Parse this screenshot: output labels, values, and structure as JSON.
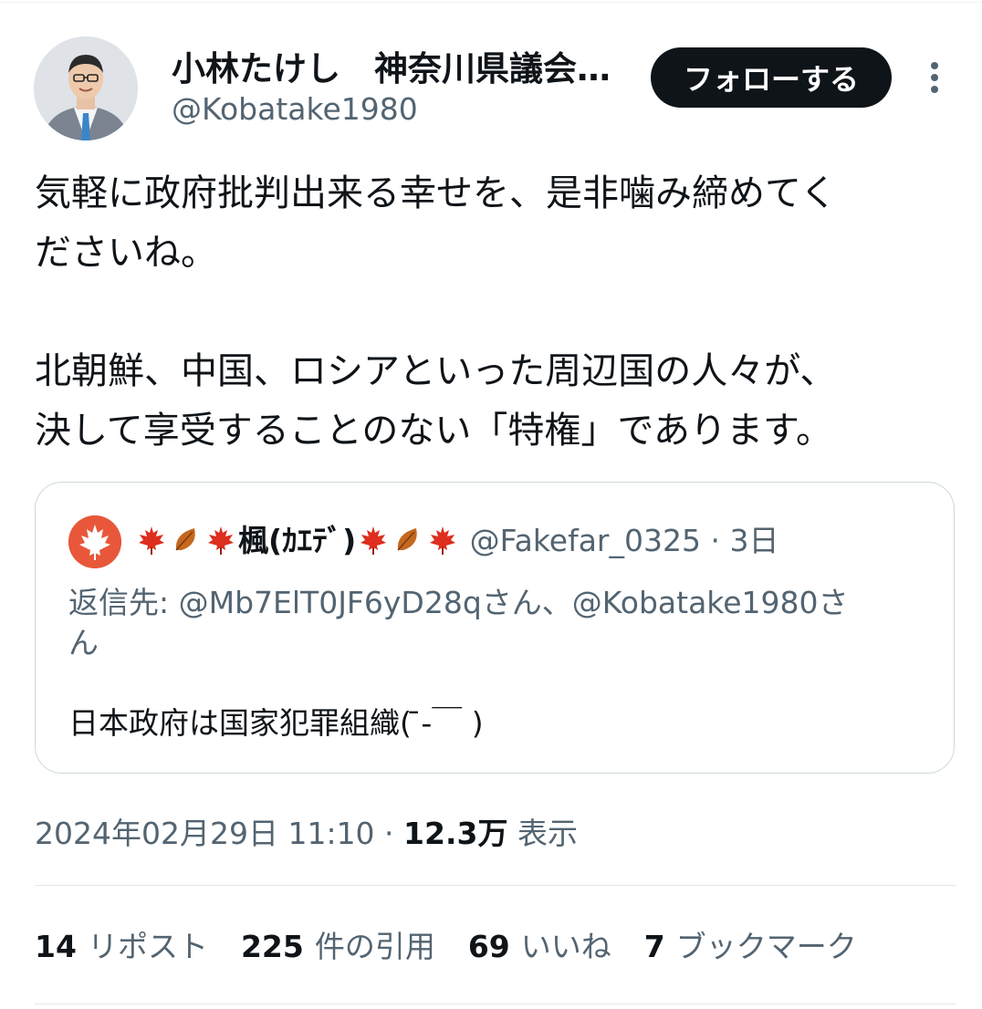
{
  "author": {
    "name": "小林たけし　神奈川県議会…",
    "handle": "@Kobatake1980"
  },
  "follow_label": "フォローする",
  "tweet": {
    "lines": [
      "気軽に政府批判出来る幸せを、是非噛み締めてく",
      "ださいね。",
      "北朝鮮、中国、ロシアといった周辺国の人々が、",
      "決して享受することのない「特権」であります。"
    ]
  },
  "quote": {
    "name": "楓(ｶｴﾃﾞ)",
    "handle": "@Fakefar_0325",
    "time": "3日",
    "reply_to_line1": "返信先: @Mb7ElT0JF6yD28qさん、@Kobatake1980さ",
    "reply_to_line2": "ん",
    "text": "日本政府は国家犯罪組織(  ̄-￣ )"
  },
  "meta": {
    "datetime": "2024年02月29日 11:10",
    "views": "12.3万",
    "views_label": "表示"
  },
  "stats": {
    "reposts": "14",
    "reposts_label": "リポスト",
    "quotes": "225",
    "quotes_label": "件の引用",
    "likes": "69",
    "likes_label": "いいね",
    "bookmarks": "7",
    "bookmarks_label": "ブックマーク"
  }
}
